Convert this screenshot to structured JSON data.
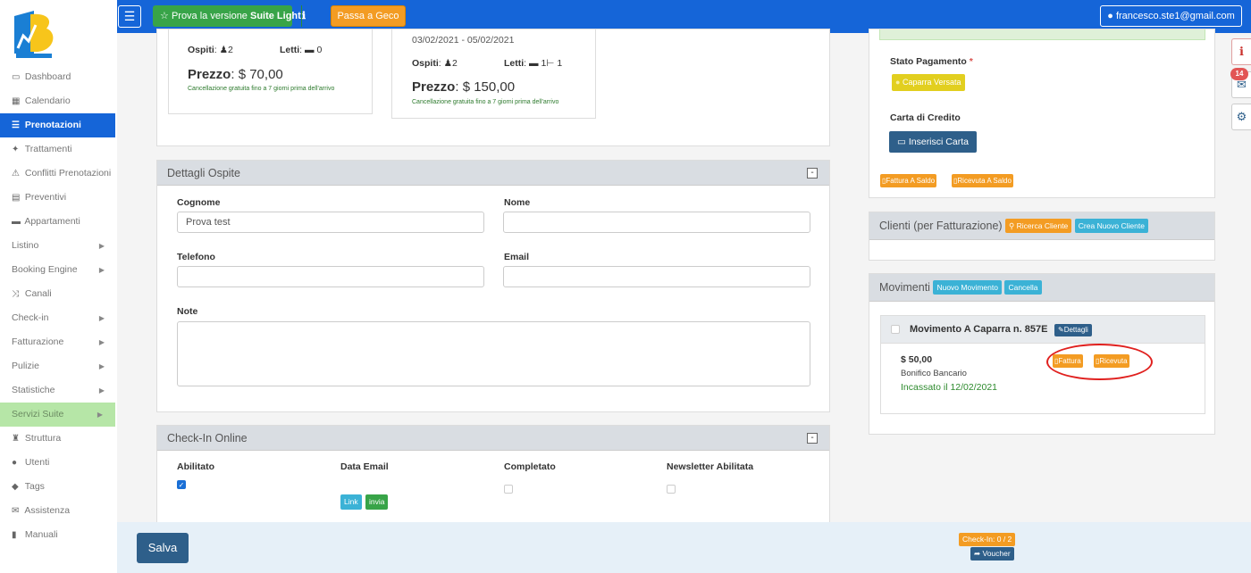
{
  "sidebar": {
    "items": [
      {
        "icon": "▭",
        "label": "Dashboard"
      },
      {
        "icon": "▦",
        "label": "Calendario"
      },
      {
        "icon": "☰",
        "label": "Prenotazioni"
      },
      {
        "icon": "✦",
        "label": "Trattamenti"
      },
      {
        "icon": "⚠",
        "label": "Conflitti Prenotazioni"
      },
      {
        "icon": "▤",
        "label": "Preventivi"
      },
      {
        "icon": "▬",
        "label": "Appartamenti"
      },
      {
        "icon": "",
        "label": "Listino"
      },
      {
        "icon": "",
        "label": "Booking Engine"
      },
      {
        "icon": "⤨",
        "label": "Canali"
      },
      {
        "icon": "",
        "label": "Check-in"
      },
      {
        "icon": "",
        "label": "Fatturazione"
      },
      {
        "icon": "",
        "label": "Pulizie"
      },
      {
        "icon": "",
        "label": "Statistiche"
      },
      {
        "icon": "",
        "label": "Servizi Suite"
      },
      {
        "icon": "♜",
        "label": "Struttura"
      },
      {
        "icon": "●",
        "label": "Utenti"
      },
      {
        "icon": "◆",
        "label": "Tags"
      },
      {
        "icon": "✉",
        "label": "Assistenza"
      },
      {
        "icon": "▮",
        "label": "Manuali"
      }
    ]
  },
  "topbar": {
    "suite_prefix": "Prova la versione ",
    "suite_bold": "Suite Light",
    "geco": "Passa a Geco",
    "user": "francesco.ste1@gmail.com"
  },
  "rooms": [
    {
      "ospiti_label": "Ospiti",
      "ospiti": "2",
      "letti_label": "Letti",
      "letti": "0",
      "price_label": "Prezzo",
      "price": "$ 70,00",
      "cancel": "Cancellazione gratuita fino a 7 giorni prima dell'arrivo"
    },
    {
      "dates": "03/02/2021 - 05/02/2021",
      "ospiti_label": "Ospiti",
      "ospiti": "2",
      "letti_label": "Letti",
      "letti_a": "1",
      "letti_b": "1",
      "price_label": "Prezzo",
      "price": "$ 150,00",
      "cancel": "Cancellazione gratuita fino a 7 giorni prima dell'arrivo"
    }
  ],
  "guest": {
    "title": "Dettagli Ospite",
    "cognome_label": "Cognome",
    "cognome_value": "Prova test",
    "nome_label": "Nome",
    "telefono_label": "Telefono",
    "email_label": "Email",
    "note_label": "Note"
  },
  "checkin": {
    "title": "Check-In Online",
    "abilitato": "Abilitato",
    "data_email": "Data Email",
    "completato": "Completato",
    "newsletter": "Newsletter Abilitata",
    "link": "Link",
    "invia": "invia"
  },
  "payment": {
    "stato_label": "Stato Pagamento",
    "required": "*",
    "stato_value": "Caparra Versata",
    "carta_label": "Carta di Credito",
    "carta_btn": "Inserisci Carta",
    "fattura_saldo": "Fattura A Saldo",
    "ricevuta_saldo": "Ricevuta A Saldo"
  },
  "clienti": {
    "title": "Clienti (per Fatturazione)",
    "ricerca": "Ricerca Cliente",
    "nuovo": "Crea Nuovo Cliente"
  },
  "movimenti": {
    "title": "Movimenti",
    "nuovo": "Nuovo Movimento",
    "cancella": "Cancella",
    "item_title": "Movimento A Caparra n. 857E",
    "dettagli": "Dettagli",
    "amount": "$ 50,00",
    "method": "Bonifico Bancario",
    "incassato": "Incassato il 12/02/2021",
    "fattura": "Fattura",
    "ricevuta": "Ricevuta"
  },
  "bottom": {
    "salva": "Salva",
    "checkin_status": "Check-In: 0 / 2",
    "voucher": "Voucher"
  },
  "badge": "14",
  "colors": {
    "primary": "#1565d8",
    "success": "#38a448",
    "warning": "#f39c23",
    "info": "#3bb2d6",
    "navy": "#2e5f8a"
  }
}
